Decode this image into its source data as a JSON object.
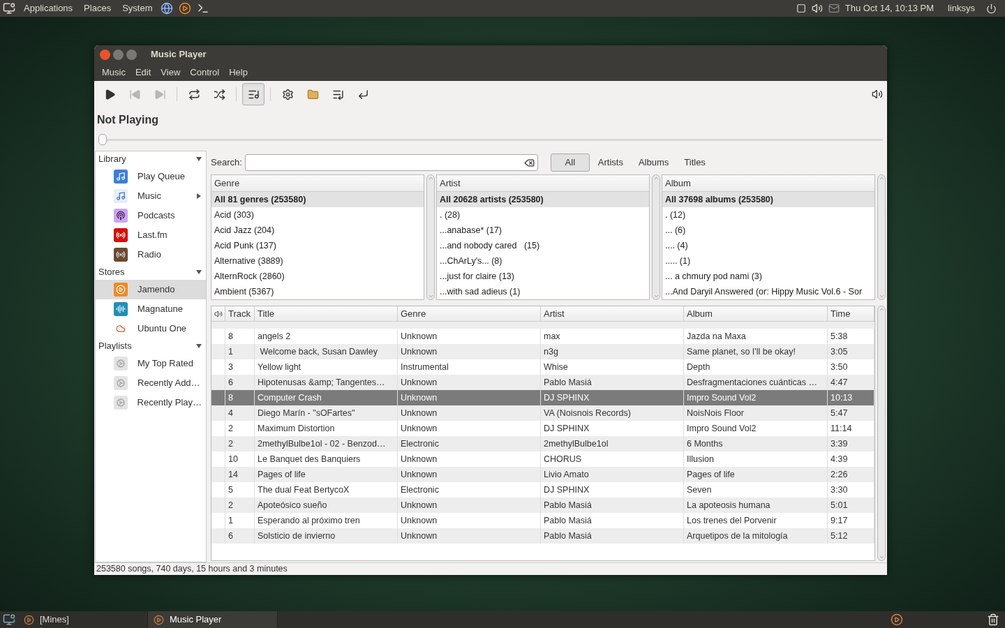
{
  "top_panel": {
    "menus": [
      "Applications",
      "Places",
      "System"
    ],
    "clock": "Thu Oct 14, 10:13 PM",
    "user": "linksys"
  },
  "window": {
    "title": "Music Player",
    "menu": [
      "Music",
      "Edit",
      "View",
      "Control",
      "Help"
    ]
  },
  "toolbar": [
    {
      "kind": "play",
      "disabled": false,
      "pressed": false
    },
    {
      "kind": "previous",
      "disabled": true,
      "pressed": false
    },
    {
      "kind": "next",
      "disabled": true,
      "pressed": false
    },
    {
      "kind": "repeat",
      "disabled": false,
      "pressed": false
    },
    {
      "kind": "shuffle",
      "disabled": false,
      "pressed": false
    },
    {
      "kind": "queue",
      "disabled": false,
      "pressed": true
    },
    {
      "kind": "settings",
      "disabled": false,
      "pressed": false
    },
    {
      "kind": "folder",
      "disabled": false,
      "pressed": false
    },
    {
      "kind": "download",
      "disabled": false,
      "pressed": false
    },
    {
      "kind": "return",
      "disabled": false,
      "pressed": false
    }
  ],
  "now_playing": {
    "title": "Not Playing",
    "position": {
      "level": 0
    }
  },
  "sidebar": [
    {
      "label": "Library",
      "expanded": true,
      "items": [
        {
          "label": "Play Queue",
          "selected": false
        },
        {
          "label": "Music",
          "selected": false,
          "expanded": false
        },
        {
          "label": "Podcasts",
          "selected": false
        },
        {
          "label": "Last.fm",
          "selected": false
        },
        {
          "label": "Radio",
          "selected": false
        }
      ]
    },
    {
      "label": "Stores",
      "expanded": true,
      "items": [
        {
          "label": "Jamendo",
          "selected": true
        },
        {
          "label": "Magnatune",
          "selected": false
        },
        {
          "label": "Ubuntu One",
          "selected": false
        }
      ]
    },
    {
      "label": "Playlists",
      "expanded": true,
      "items": [
        {
          "label": "My Top Rated",
          "selected": false
        },
        {
          "label": "Recently Add…",
          "selected": false
        },
        {
          "label": "Recently Play…",
          "selected": false
        }
      ]
    }
  ],
  "search": {
    "label": "Search:"
  },
  "filters": [
    {
      "label": "All",
      "selected": true
    },
    {
      "label": "Artists",
      "selected": false
    },
    {
      "label": "Albums",
      "selected": false
    },
    {
      "label": "Titles",
      "selected": false
    }
  ],
  "browsers": [
    {
      "header": "Genre",
      "items": [
        {
          "label": "All 81 genres (253580)",
          "selected": true
        },
        {
          "label": "Acid (303)",
          "selected": false
        },
        {
          "label": "Acid Jazz (204)",
          "selected": false
        },
        {
          "label": "Acid Punk (137)",
          "selected": false
        },
        {
          "label": "Alternative (3889)",
          "selected": false
        },
        {
          "label": "AlternRock (2860)",
          "selected": false
        },
        {
          "label": "Ambient (5367)",
          "selected": false
        }
      ]
    },
    {
      "header": "Artist",
      "items": [
        {
          "label": "All 20628 artists (253580)",
          "selected": true
        },
        {
          "label": ". (28)",
          "selected": false
        },
        {
          "label": "...anabase* (17)",
          "selected": false
        },
        {
          "label": "...and nobody cared   (15)",
          "selected": false
        },
        {
          "label": "...ChArLy's... (8)",
          "selected": false
        },
        {
          "label": "...just for claire (13)",
          "selected": false
        },
        {
          "label": "...with sad adieus (1)",
          "selected": false
        }
      ]
    },
    {
      "header": "Album",
      "items": [
        {
          "label": "All 37698 albums (253580)",
          "selected": true
        },
        {
          "label": ". (12)",
          "selected": false
        },
        {
          "label": "... (6)",
          "selected": false
        },
        {
          "label": ".... (4)",
          "selected": false
        },
        {
          "label": "..... (1)",
          "selected": false
        },
        {
          "label": "... a chmury pod nami (3)",
          "selected": false
        },
        {
          "label": "...And Daryil Answered (or: Hippy Music Vol.6 - Sor",
          "selected": false
        }
      ]
    }
  ],
  "tracks": {
    "columns": [
      "Track",
      "Title",
      "Genre",
      "Artist",
      "Album",
      "Time"
    ],
    "rows": [
      {
        "selected": false,
        "cells": [
          "8",
          "angels 2",
          "Unknown",
          "max",
          "Jazda na Maxa",
          "5:38"
        ]
      },
      {
        "selected": false,
        "cells": [
          "1",
          " Welcome back, Susan Dawley",
          "Unknown",
          "n3g",
          "Same planet, so I'll be okay!",
          "3:05"
        ]
      },
      {
        "selected": false,
        "cells": [
          "3",
          "Yellow light",
          "Instrumental",
          "Whise",
          "Depth",
          "3:50"
        ]
      },
      {
        "selected": false,
        "cells": [
          "6",
          "Hipotenusas &amp; Tangentes…",
          "Unknown",
          "Pablo Masiá",
          "Desfragmentaciones cuánticas …",
          "4:47"
        ]
      },
      {
        "selected": true,
        "cells": [
          "8",
          "Computer Crash",
          "Unknown",
          "DJ SPHINX",
          "Impro Sound Vol2",
          "10:13"
        ]
      },
      {
        "selected": false,
        "cells": [
          "4",
          "Diego Marín - \"sOFartes\"",
          "Unknown",
          "VA (Noisnois Records)",
          "NoisNois Floor",
          "5:47"
        ]
      },
      {
        "selected": false,
        "cells": [
          "2",
          "Maximum Distortion",
          "Unknown",
          "DJ SPHINX",
          "Impro Sound Vol2",
          "11:14"
        ]
      },
      {
        "selected": false,
        "cells": [
          "2",
          "2methylBulbe1ol - 02 - Benzod…",
          "Electronic",
          "2methylBulbe1ol",
          "6 Months",
          "3:39"
        ]
      },
      {
        "selected": false,
        "cells": [
          "10",
          "Le Banquet des Banquiers",
          "Unknown",
          "CHORUS",
          "Illusion",
          "4:39"
        ]
      },
      {
        "selected": false,
        "cells": [
          "14",
          "Pages of life",
          "Unknown",
          "Livio Amato",
          "Pages of life",
          "2:26"
        ]
      },
      {
        "selected": false,
        "cells": [
          "5",
          "The dual Feat BertycoX",
          "Electronic",
          "DJ SPHINX",
          "Seven",
          "3:30"
        ]
      },
      {
        "selected": false,
        "cells": [
          "2",
          "Apoteósico sueño",
          "Unknown",
          "Pablo Masiá",
          "La apoteosis humana",
          "5:01"
        ]
      },
      {
        "selected": false,
        "cells": [
          "1",
          "Esperando al próximo tren",
          "Unknown",
          "Pablo Masiá",
          "Los trenes del Porvenir",
          "9:17"
        ]
      },
      {
        "selected": false,
        "cells": [
          "6",
          "Solsticio de invierno",
          "Unknown",
          "Pablo Masiá",
          "Arquetipos de la mitología",
          "5:12"
        ]
      }
    ]
  },
  "status": "253580 songs, 740 days, 15 hours and 3 minutes",
  "taskbar": [
    {
      "label": "[Mines]",
      "selected": false
    },
    {
      "label": "Music Player",
      "selected": true
    }
  ]
}
